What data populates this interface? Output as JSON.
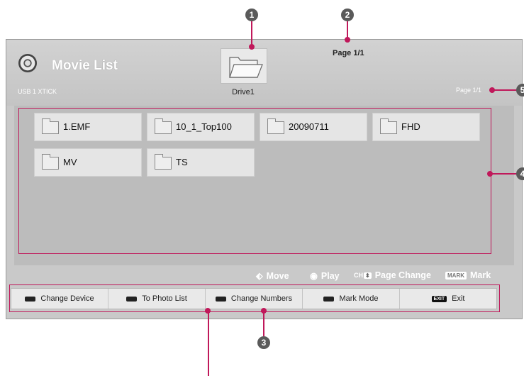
{
  "header": {
    "title": "Movie List",
    "device_label": "USB 1 XTICK",
    "drive_label": "Drive1",
    "page_top": "Page 1/1",
    "page_right": "Page 1/1"
  },
  "folders": [
    {
      "name": "1.EMF"
    },
    {
      "name": "10_1_Top100"
    },
    {
      "name": "20090711"
    },
    {
      "name": "FHD"
    },
    {
      "name": "MV"
    },
    {
      "name": "TS"
    }
  ],
  "hints": {
    "move": "Move",
    "play": "Play",
    "ch_badge": "CH",
    "page_change": "Page Change",
    "mark_badge": "MARK",
    "mark": "Mark"
  },
  "buttons": [
    {
      "label": "Change Device"
    },
    {
      "label": "To Photo List"
    },
    {
      "label": "Change Numbers"
    },
    {
      "label": "Mark Mode"
    },
    {
      "label": "Exit",
      "key_label": "EXIT"
    }
  ],
  "callouts": [
    "1",
    "2",
    "3",
    "4",
    "5"
  ],
  "colors": {
    "callout": "#c0185a",
    "screen_bg": "#c9c9c9",
    "button_bar_bg": "#e9e9e9"
  }
}
